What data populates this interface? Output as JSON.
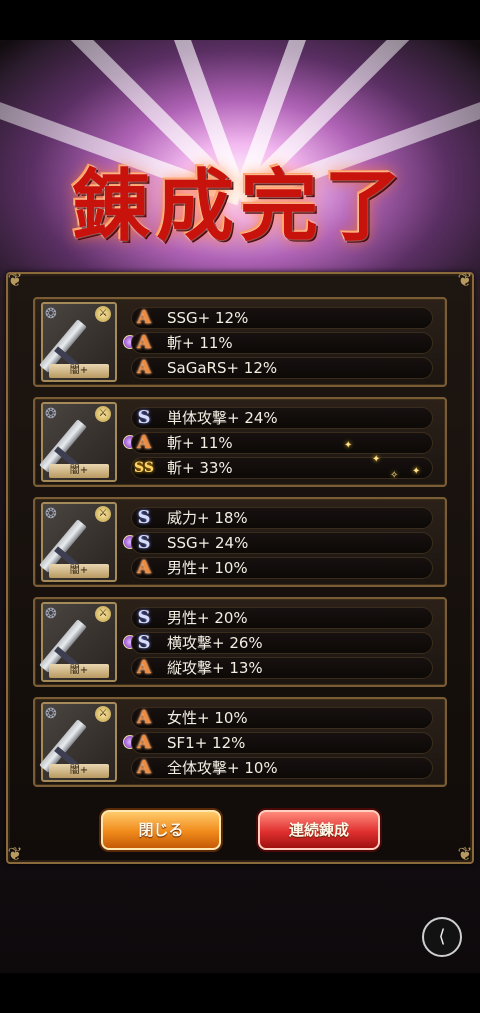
{
  "title": "錬成完了",
  "accent_colors": {
    "rank_a": "#f08a3c",
    "rank_s": "#d8ddf5",
    "rank_ss": "#ffd36b",
    "close_button": "#f08a1a",
    "forge_button": "#e03030"
  },
  "items": [
    {
      "thumb_label": "闇+",
      "rows": [
        {
          "rank": "A",
          "text": "SSG+ 12%"
        },
        {
          "rank": "A",
          "text": "斬+ 11%"
        },
        {
          "rank": "A",
          "text": "SaGaRS+ 12%"
        }
      ]
    },
    {
      "thumb_label": "闇+",
      "rows": [
        {
          "rank": "S",
          "text": "単体攻撃+ 24%"
        },
        {
          "rank": "A",
          "text": "斬+ 11%"
        },
        {
          "rank": "SS",
          "text": "斬+ 33%"
        }
      ]
    },
    {
      "thumb_label": "闇+",
      "rows": [
        {
          "rank": "S",
          "text": "威力+ 18%"
        },
        {
          "rank": "S",
          "text": "SSG+ 24%"
        },
        {
          "rank": "A",
          "text": "男性+ 10%"
        }
      ]
    },
    {
      "thumb_label": "闇+",
      "rows": [
        {
          "rank": "S",
          "text": "男性+ 20%"
        },
        {
          "rank": "S",
          "text": "横攻撃+ 26%"
        },
        {
          "rank": "A",
          "text": "縦攻撃+ 13%"
        }
      ]
    },
    {
      "thumb_label": "闇+",
      "rows": [
        {
          "rank": "A",
          "text": "女性+ 10%"
        },
        {
          "rank": "A",
          "text": "SF1+ 12%"
        },
        {
          "rank": "A",
          "text": "全体攻撃+ 10%"
        }
      ]
    }
  ],
  "rank_glyphs": {
    "A": "A",
    "S": "S",
    "SS": "SS"
  },
  "buttons": {
    "close": "閉じる",
    "forge_again": "連続錬成"
  },
  "icons": {
    "share": "share-icon",
    "chain": "chain-icon",
    "weapon_type": "sword-icon"
  }
}
